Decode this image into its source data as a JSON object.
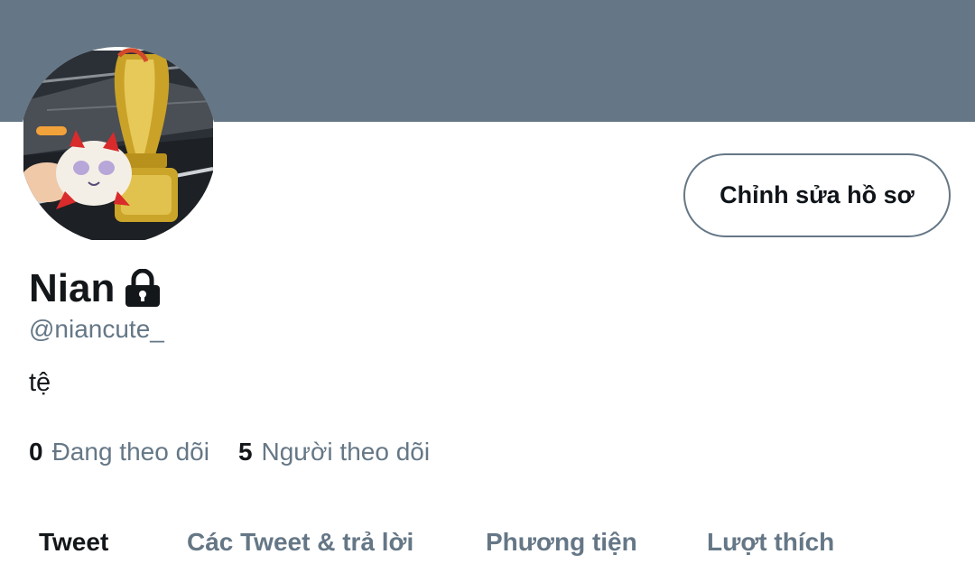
{
  "header": {
    "banner_color": "#657786"
  },
  "profile": {
    "display_name": "Nian",
    "handle": "@niancute_",
    "bio": "tệ",
    "locked": true,
    "avatar_icon": "avatar-photo"
  },
  "actions": {
    "edit_profile_label": "Chỉnh sửa hồ sơ"
  },
  "stats": {
    "following_count": "0",
    "following_label": "Đang theo dõi",
    "followers_count": "5",
    "followers_label": "Người theo dõi"
  },
  "tabs": [
    {
      "label": "Tweet",
      "active": true
    },
    {
      "label": "Các Tweet & trả lời",
      "active": false
    },
    {
      "label": "Phương tiện",
      "active": false
    },
    {
      "label": "Lượt thích",
      "active": false
    }
  ],
  "colors": {
    "text_primary": "#14171a",
    "text_secondary": "#657786",
    "border": "#657786"
  }
}
